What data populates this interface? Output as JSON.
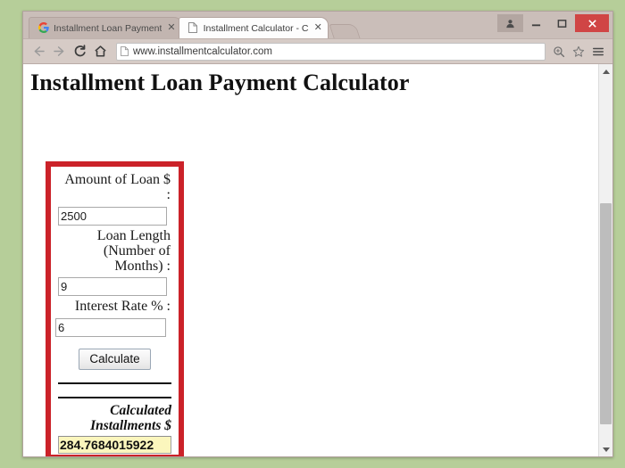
{
  "browser": {
    "tabs": [
      {
        "title": "Installment Loan Payment",
        "favicon": "google-g-icon",
        "active": false,
        "close_label": "✕"
      },
      {
        "title": "Installment Calculator - Ca",
        "favicon": "page-icon",
        "active": true,
        "close_label": "✕"
      }
    ],
    "new_tab_name": "new-tab-button",
    "window_controls": {
      "user": "⚇",
      "minimize": "–",
      "maximize": "☐",
      "close": "✕"
    },
    "toolbar": {
      "back": "←",
      "forward": "→",
      "reload": "C",
      "home": "⌂",
      "url": "www.installmentcalculator.com",
      "zoom_icon": "⊕",
      "bookmark_icon": "☆",
      "menu_icon": "☰"
    }
  },
  "page": {
    "title": "Installment Loan Payment Calculator",
    "form": {
      "fields": [
        {
          "label": "Amount of Loan $ :",
          "value": "2500",
          "name": "loan-amount"
        },
        {
          "label": "Loan Length (Number of Months) :",
          "value": "9",
          "name": "loan-length-months"
        },
        {
          "label": "Interest Rate % :",
          "value": "6",
          "name": "interest-rate"
        }
      ],
      "calculate_label": "Calculate",
      "result_label": "Calculated Installments $",
      "result_value": "284.7684015922"
    },
    "accent_color": "#cb2229",
    "highlight_color": "#fbf6bd"
  }
}
